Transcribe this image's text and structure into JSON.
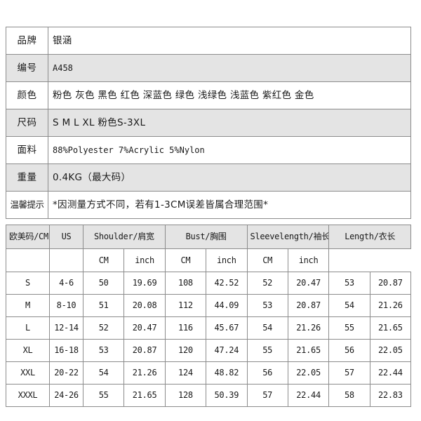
{
  "spec": {
    "rows": [
      {
        "label": "品牌",
        "value": "银涵",
        "mono": false
      },
      {
        "label": "编号",
        "value": "A458",
        "mono": true
      },
      {
        "label": "颜色",
        "value": "粉色 灰色 黑色 红色 深蓝色 绿色 浅绿色 浅蓝色 紫红色 金色",
        "mono": false
      },
      {
        "label": "尺码",
        "value": "S M L XL  粉色S-3XL",
        "mono": false
      },
      {
        "label": "面料",
        "value": "88%Polyester  7%Acrylic  5%Nylon",
        "mono": true
      },
      {
        "label": "重量",
        "value": "0.4KG（最大码）",
        "mono": false
      },
      {
        "label": "温馨提示",
        "value": "*因测量方式不同，若有1-3CM误差皆属合理范围*",
        "mono": false
      }
    ]
  },
  "size_chart": {
    "type": "table",
    "group_headers": [
      "欧美码/CM",
      "US",
      "Shoulder/肩宽",
      "Bust/胸围",
      "Sleevelength/袖长",
      "Length/衣长"
    ],
    "unit_headers": [
      "",
      "",
      "CM",
      "inch",
      "CM",
      "inch",
      "CM",
      "inch"
    ],
    "rows": [
      {
        "size": "S",
        "us": "4-6",
        "shoulder_cm": "50",
        "shoulder_in": "19.69",
        "bust_cm": "108",
        "bust_in": "42.52",
        "sleeve_cm": "52",
        "sleeve_in": "20.47",
        "length_cm": "53",
        "length_in": "20.87"
      },
      {
        "size": "M",
        "us": "8-10",
        "shoulder_cm": "51",
        "shoulder_in": "20.08",
        "bust_cm": "112",
        "bust_in": "44.09",
        "sleeve_cm": "53",
        "sleeve_in": "20.87",
        "length_cm": "54",
        "length_in": "21.26"
      },
      {
        "size": "L",
        "us": "12-14",
        "shoulder_cm": "52",
        "shoulder_in": "20.47",
        "bust_cm": "116",
        "bust_in": "45.67",
        "sleeve_cm": "54",
        "sleeve_in": "21.26",
        "length_cm": "55",
        "length_in": "21.65"
      },
      {
        "size": "XL",
        "us": "16-18",
        "shoulder_cm": "53",
        "shoulder_in": "20.87",
        "bust_cm": "120",
        "bust_in": "47.24",
        "sleeve_cm": "55",
        "sleeve_in": "21.65",
        "length_cm": "56",
        "length_in": "22.05"
      },
      {
        "size": "XXL",
        "us": "20-22",
        "shoulder_cm": "54",
        "shoulder_in": "21.26",
        "bust_cm": "124",
        "bust_in": "48.82",
        "sleeve_cm": "56",
        "sleeve_in": "22.05",
        "length_cm": "57",
        "length_in": "22.44"
      },
      {
        "size": "XXXL",
        "us": "24-26",
        "shoulder_cm": "55",
        "shoulder_in": "21.65",
        "bust_cm": "128",
        "bust_in": "50.39",
        "sleeve_cm": "57",
        "sleeve_in": "22.44",
        "length_cm": "58",
        "length_in": "22.83"
      }
    ]
  },
  "colors": {
    "border": "#8c8c8c",
    "shaded_row": "#e4e4e4",
    "text": "#1a1a1a",
    "background": "#ffffff"
  }
}
